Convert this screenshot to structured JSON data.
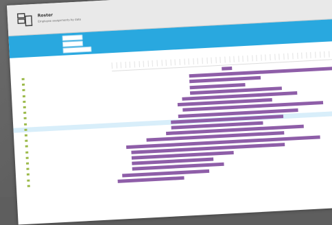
{
  "header": {
    "title": "Roster",
    "subtitle": "Employee assignments by date"
  },
  "filters": {
    "label1": "",
    "label2": "",
    "label3": ""
  },
  "columns": {
    "col1": "",
    "col2": "",
    "col3": ""
  },
  "timeline": {
    "months": [
      "",
      "",
      "",
      ""
    ]
  },
  "rows": [
    {
      "start": 0.43,
      "end": 0.47
    },
    {
      "start": 0.3,
      "end": 1.0
    },
    {
      "start": 0.3,
      "end": 0.58
    },
    {
      "start": 0.3,
      "end": 0.52
    },
    {
      "start": 0.3,
      "end": 0.66
    },
    {
      "start": 0.27,
      "end": 0.72
    },
    {
      "start": 0.25,
      "end": 0.62
    },
    {
      "start": 0.27,
      "end": 0.82
    },
    {
      "start": 0.25,
      "end": 0.72
    },
    {
      "start": 0.22,
      "end": 0.66
    },
    {
      "start": 0.22,
      "end": 0.58
    },
    {
      "start": 0.2,
      "end": 0.74
    },
    {
      "start": 0.12,
      "end": 0.66
    },
    {
      "start": 0.04,
      "end": 0.8
    },
    {
      "start": 0.06,
      "end": 0.66
    },
    {
      "start": 0.06,
      "end": 0.46
    },
    {
      "start": 0.06,
      "end": 0.38
    },
    {
      "start": 0.06,
      "end": 0.42
    },
    {
      "start": 0.02,
      "end": 0.36
    },
    {
      "start": 0.0,
      "end": 0.26
    }
  ],
  "colors": {
    "bar": "#8e5ea8",
    "accent": "#29a8df",
    "row_icon": "#9cba4a"
  }
}
